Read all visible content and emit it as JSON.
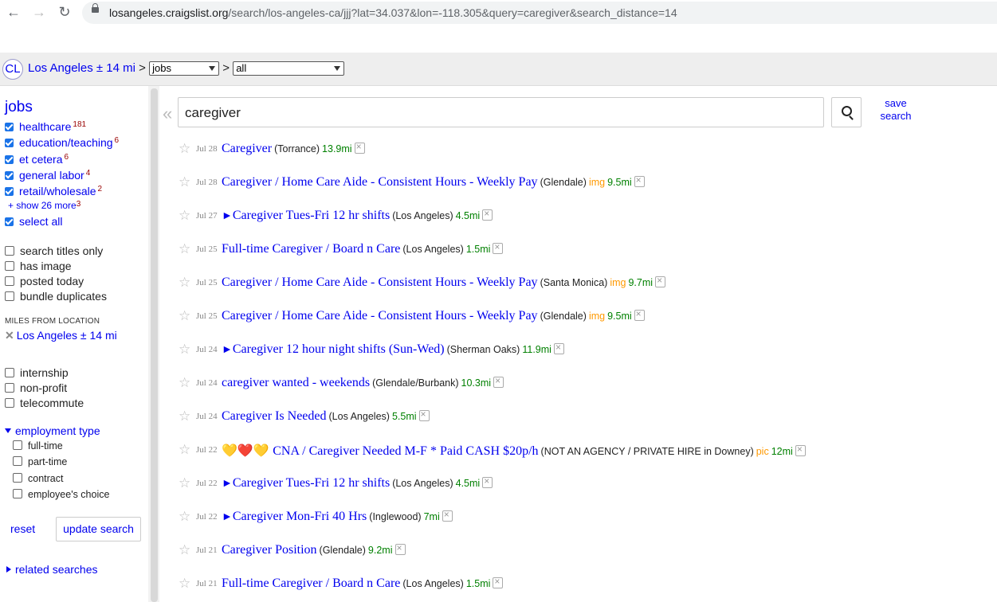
{
  "browser": {
    "back_icon": "←",
    "forward_icon": "→",
    "reload_icon": "↻",
    "url_host": "losangeles.craigslist.org",
    "url_path": "/search/los-angeles-ca/jjj?lat=34.037&lon=-118.305&query=caregiver&search_distance=14"
  },
  "topbar": {
    "logo": "CL",
    "location": "Los Angeles ± 14 mi",
    "sep1": ">",
    "category_select": "jobs",
    "sep2": ">",
    "subcategory_select": "all"
  },
  "sidebar": {
    "title": "jobs",
    "categories": [
      {
        "label": "healthcare",
        "count": "181"
      },
      {
        "label": "education/teaching",
        "count": "6"
      },
      {
        "label": "et cetera",
        "count": "6"
      },
      {
        "label": "general labor",
        "count": "4"
      },
      {
        "label": "retail/wholesale",
        "count": "2"
      }
    ],
    "show_more": "+ show 26 more",
    "show_more_count": "3",
    "select_all": "select all",
    "filters": [
      "search titles only",
      "has image",
      "posted today",
      "bundle duplicates"
    ],
    "miles_label": "MILES FROM LOCATION",
    "miles_value": "Los Angeles ± 14 mi",
    "miles_x": "✕",
    "job_filters": [
      "internship",
      "non-profit",
      "telecommute"
    ],
    "employment_type": "employment type",
    "employment_options": [
      "full-time",
      "part-time",
      "contract",
      "employee's choice"
    ],
    "reset": "reset",
    "update": "update search",
    "related": "related searches"
  },
  "search": {
    "collapse": "«",
    "query": "caregiver",
    "save_line1": "save",
    "save_line2": "search"
  },
  "results": [
    {
      "date": "Jul 28",
      "prefix": "",
      "title": "Caregiver",
      "hood": "(Torrance)",
      "tag": "",
      "miles": "13.9mi"
    },
    {
      "date": "Jul 28",
      "prefix": "",
      "title": "Caregiver / Home Care Aide - Consistent Hours - Weekly Pay",
      "hood": "(Glendale)",
      "tag": "img",
      "miles": "9.5mi"
    },
    {
      "date": "Jul 27",
      "prefix": "►",
      "title": "Caregiver Tues-Fri 12 hr shifts",
      "hood": "(Los Angeles)",
      "tag": "",
      "miles": "4.5mi"
    },
    {
      "date": "Jul 25",
      "prefix": "",
      "title": "Full-time Caregiver / Board n Care",
      "hood": "(Los Angeles)",
      "tag": "",
      "miles": "1.5mi"
    },
    {
      "date": "Jul 25",
      "prefix": "",
      "title": "Caregiver / Home Care Aide - Consistent Hours - Weekly Pay",
      "hood": "(Santa Monica)",
      "tag": "img",
      "miles": "9.7mi"
    },
    {
      "date": "Jul 25",
      "prefix": "",
      "title": "Caregiver / Home Care Aide - Consistent Hours - Weekly Pay",
      "hood": "(Glendale)",
      "tag": "img",
      "miles": "9.5mi"
    },
    {
      "date": "Jul 24",
      "prefix": "►",
      "title": "Caregiver 12 hour night shifts (Sun-Wed)",
      "hood": "(Sherman Oaks)",
      "tag": "",
      "miles": "11.9mi"
    },
    {
      "date": "Jul 24",
      "prefix": "",
      "title": "caregiver wanted - weekends",
      "hood": "(Glendale/Burbank)",
      "tag": "",
      "miles": "10.3mi"
    },
    {
      "date": "Jul 24",
      "prefix": "",
      "title": "Caregiver Is Needed",
      "hood": "(Los Angeles)",
      "tag": "",
      "miles": "5.5mi"
    },
    {
      "date": "Jul 22",
      "prefix": "💛❤️💛",
      "title": "CNA / Caregiver Needed M-F * Paid CASH $20p/h",
      "hood": "(NOT AN AGENCY / PRIVATE HIRE in Downey)",
      "tag": "pic",
      "miles": "12mi"
    },
    {
      "date": "Jul 22",
      "prefix": "►",
      "title": "Caregiver Tues-Fri 12 hr shifts",
      "hood": "(Los Angeles)",
      "tag": "",
      "miles": "4.5mi"
    },
    {
      "date": "Jul 22",
      "prefix": "►",
      "title": "Caregiver Mon-Fri 40 Hrs",
      "hood": "(Inglewood)",
      "tag": "",
      "miles": "7mi"
    },
    {
      "date": "Jul 21",
      "prefix": "",
      "title": "Caregiver Position",
      "hood": "(Glendale)",
      "tag": "",
      "miles": "9.2mi"
    },
    {
      "date": "Jul 21",
      "prefix": "",
      "title": "Full-time Caregiver / Board n Care",
      "hood": "(Los Angeles)",
      "tag": "",
      "miles": "1.5mi"
    }
  ]
}
